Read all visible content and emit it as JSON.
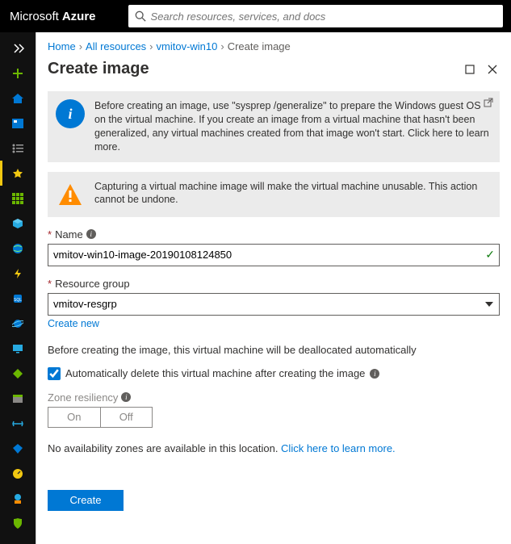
{
  "brand": {
    "word1": "Microsoft",
    "word2": "Azure"
  },
  "search": {
    "placeholder": "Search resources, services, and docs"
  },
  "breadcrumbs": {
    "home": "Home",
    "allres": "All resources",
    "vm": "vmitov-win10",
    "current": "Create image"
  },
  "blade": {
    "title": "Create image"
  },
  "notice_info": "Before creating an image, use \"sysprep /generalize\" to prepare the Windows guest OS on the virtual machine. If you create an image from a virtual machine that hasn't been generalized, any virtual machines created from that image won't start. Click here to learn more.",
  "notice_warn": "Capturing a virtual machine image will make the virtual machine unusable. This action cannot be undone.",
  "form": {
    "name_label": "Name",
    "name_value": "vmitov-win10-image-20190108124850",
    "rg_label": "Resource group",
    "rg_value": "vmitov-resgrp",
    "create_new": "Create new",
    "dealloc_text": "Before creating the image, this virtual machine will be deallocated automatically",
    "auto_delete_label": "Automatically delete this virtual machine after creating the image",
    "auto_delete_checked": true,
    "zone_label": "Zone resiliency",
    "zone_on": "On",
    "zone_off": "Off",
    "avail_text": "No availability zones are available in this location. ",
    "avail_link": "Click here to learn more.",
    "create_btn": "Create"
  },
  "star_asterisk": "*"
}
